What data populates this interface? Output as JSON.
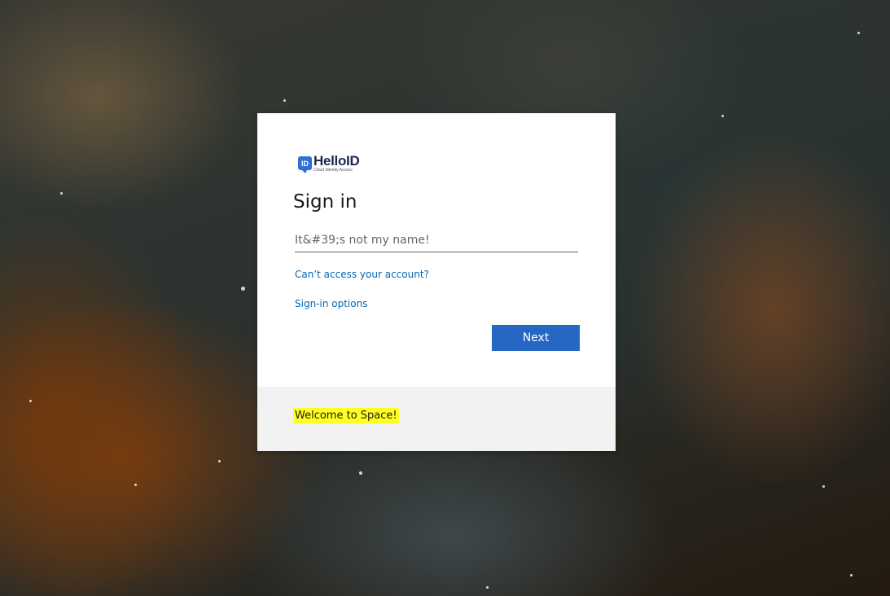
{
  "brand": {
    "logo_badge": "ID",
    "logo_name": "HelloID",
    "logo_tagline": "Cloud Identity Access",
    "accent_color": "#2767c4"
  },
  "signin": {
    "title": "Sign in",
    "username_placeholder": "It&#39;s not my name!",
    "cant_access_link": "Can’t access your account?",
    "signin_options_link": "Sign-in options",
    "next_button": "Next"
  },
  "footer": {
    "welcome_text": "Welcome to Space!",
    "highlight_color": "#ffff22"
  },
  "background": {
    "description_icon": "nebula-background"
  }
}
